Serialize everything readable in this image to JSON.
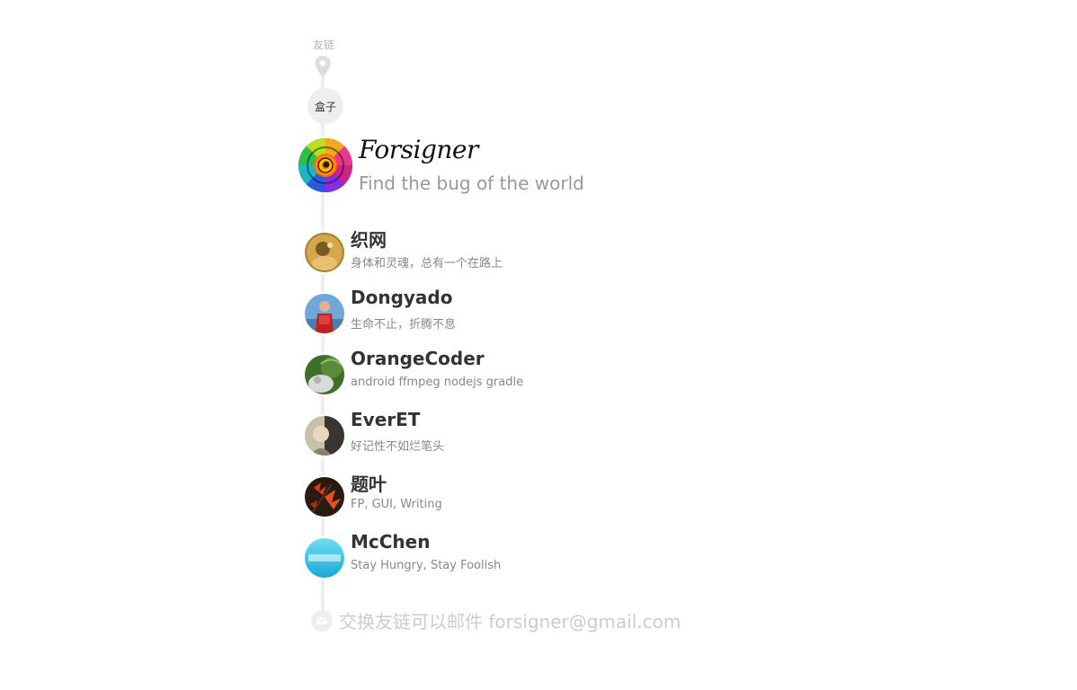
{
  "section": {
    "label": "友链"
  },
  "box": {
    "label": "盒子"
  },
  "profile": {
    "name": "Forsigner",
    "tagline": "Find the bug of the world"
  },
  "friends": [
    {
      "name": "织网",
      "desc": "身体和灵魂，总有一个在路上"
    },
    {
      "name": "Dongyado",
      "desc": "生命不止，折腾不息"
    },
    {
      "name": "OrangeCoder",
      "desc": "android ffmpeg nodejs gradle"
    },
    {
      "name": "EverET",
      "desc": "好记性不如烂笔头"
    },
    {
      "name": "题叶",
      "desc": "FP, GUI, Writing"
    },
    {
      "name": "McChen",
      "desc": "Stay Hungry, Stay Foolish"
    }
  ],
  "footer": {
    "text": "交换友链可以邮件 forsigner@gmail.com"
  }
}
